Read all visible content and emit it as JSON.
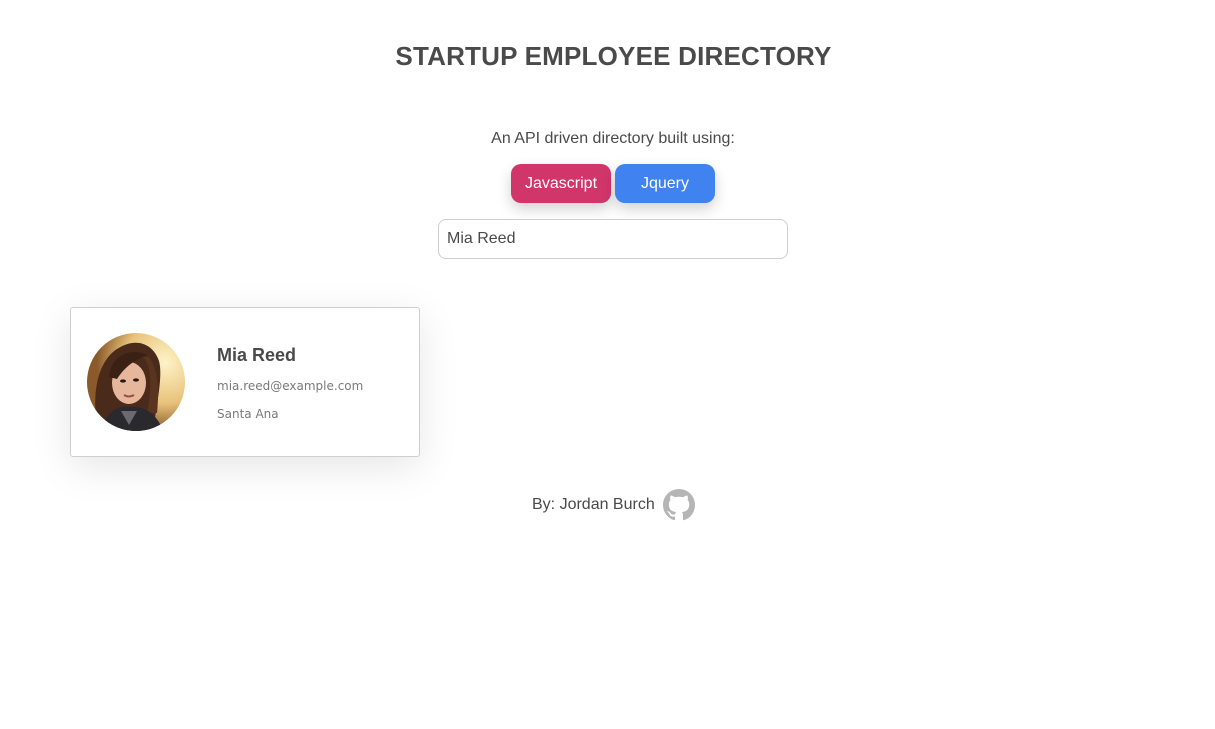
{
  "header": {
    "title": "STARTUP EMPLOYEE DIRECTORY",
    "subtitle": "An API driven directory built using:"
  },
  "tech_buttons": [
    {
      "label": "Javascript",
      "color": "#d1366b"
    },
    {
      "label": "Jquery",
      "color": "#3f82f0"
    }
  ],
  "search": {
    "value": "Mia Reed",
    "placeholder": ""
  },
  "employees": [
    {
      "name": "Mia Reed",
      "email": "mia.reed@example.com",
      "city": "Santa Ana",
      "avatar_icon": "profile-photo"
    }
  ],
  "footer": {
    "credit": "By: Jordan Burch",
    "icon": "github-icon"
  }
}
